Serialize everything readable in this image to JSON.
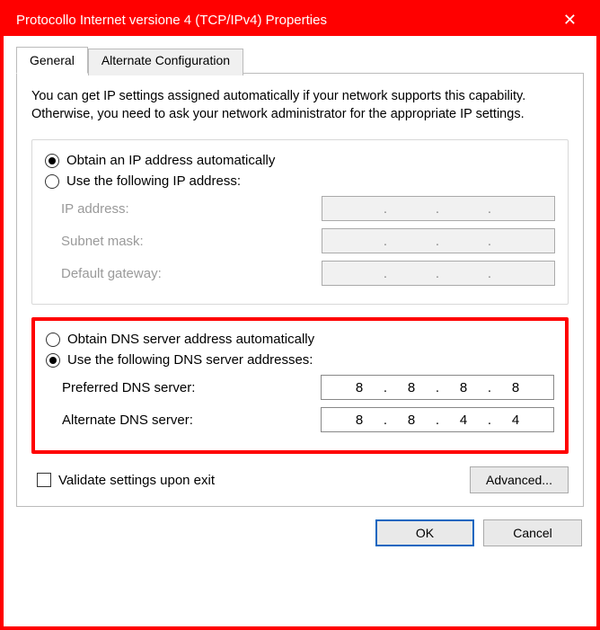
{
  "window": {
    "title": "Protocollo Internet versione 4 (TCP/IPv4) Properties"
  },
  "tabs": {
    "general": "General",
    "alternate": "Alternate Configuration"
  },
  "description": "You can get IP settings assigned automatically if your network supports this capability. Otherwise, you need to ask your network administrator for the appropriate IP settings.",
  "ip": {
    "obtain_auto": "Obtain an IP address automatically",
    "obtain_auto_ul": "O",
    "use_following": "Use the following IP address:",
    "use_following_ul": "s",
    "ip_label": "IP address:",
    "ip_ul": "I",
    "subnet_label": "Subnet mask:",
    "subnet_ul": "u",
    "gateway_label": "Default gateway:",
    "gateway_ul": "D",
    "selected": "auto"
  },
  "dns": {
    "obtain_auto": "Obtain DNS server address automatically",
    "obtain_auto_ul": "b",
    "use_following": "Use the following DNS server addresses:",
    "use_following_ul": "e",
    "preferred_label": "Preferred DNS server:",
    "preferred_ul": "P",
    "alternate_label": "Alternate DNS server:",
    "alternate_ul": "A",
    "selected": "manual",
    "preferred": [
      "8",
      "8",
      "8",
      "8"
    ],
    "alternate": [
      "8",
      "8",
      "4",
      "4"
    ]
  },
  "validate_label": "Validate settings upon exit",
  "validate_ul": "l",
  "validate_checked": false,
  "buttons": {
    "advanced": "Advanced...",
    "advanced_ul": "v",
    "ok": "OK",
    "cancel": "Cancel"
  }
}
